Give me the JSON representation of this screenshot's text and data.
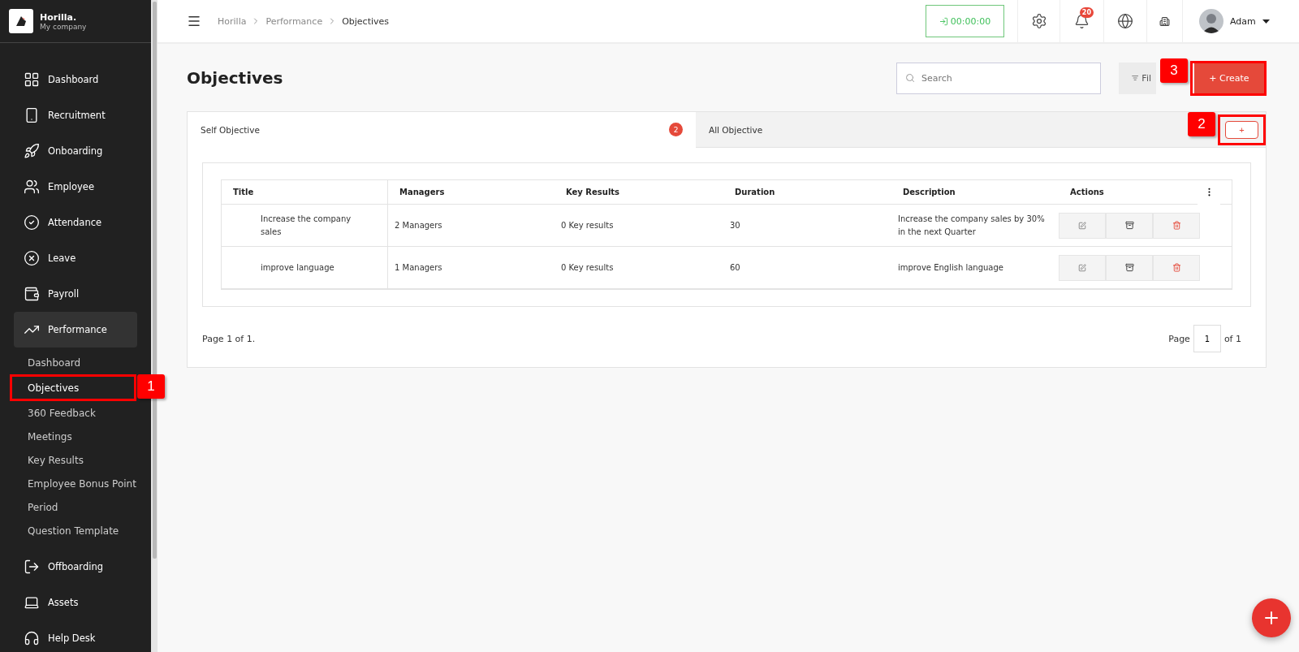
{
  "brand": {
    "name": "Horilla.",
    "company": "My company"
  },
  "nav": [
    {
      "label": "Dashboard",
      "selected": false
    },
    {
      "label": "Recruitment",
      "selected": false
    },
    {
      "label": "Onboarding",
      "selected": false
    },
    {
      "label": "Employee",
      "selected": false
    },
    {
      "label": "Attendance",
      "selected": false
    },
    {
      "label": "Leave",
      "selected": false
    },
    {
      "label": "Payroll",
      "selected": false
    },
    {
      "label": "Performance",
      "selected": true,
      "children": [
        {
          "label": "Dashboard",
          "selected": false
        },
        {
          "label": "Objectives",
          "selected": true,
          "callout": "1"
        },
        {
          "label": "360 Feedback",
          "selected": false
        },
        {
          "label": "Meetings",
          "selected": false
        },
        {
          "label": "Key Results",
          "selected": false
        },
        {
          "label": "Employee Bonus Point",
          "selected": false
        },
        {
          "label": "Period",
          "selected": false
        },
        {
          "label": "Question Template",
          "selected": false
        }
      ]
    },
    {
      "label": "Offboarding",
      "selected": false
    },
    {
      "label": "Assets",
      "selected": false
    },
    {
      "label": "Help Desk",
      "selected": false
    }
  ],
  "breadcrumb": [
    "Horilla",
    "Performance",
    "Objectives"
  ],
  "timer": "00:00:00",
  "notifications": "20",
  "user": "Adam",
  "page_title": "Objectives",
  "search": {
    "placeholder": "Search"
  },
  "filter_button": "Fil",
  "create_button": {
    "label": "+ Create",
    "callout": "3"
  },
  "tabs": [
    {
      "label": "Self Objective",
      "badge": "2",
      "selected": true
    },
    {
      "label": "All Objective",
      "selected": false
    }
  ],
  "add_tab_button": {
    "label": "+",
    "callout": "2"
  },
  "table": {
    "columns": [
      "Title",
      "Managers",
      "Key Results",
      "Duration",
      "Description",
      "Actions"
    ],
    "rows": [
      [
        "Increase the company sales",
        "2 Managers",
        "0 Key results",
        "30",
        "Increase the company sales by 30% in the next Quarter"
      ],
      [
        "improve language",
        "1 Managers",
        "0 Key results",
        "60",
        "improve English language"
      ]
    ]
  },
  "pagination": {
    "summary": "Page 1 of 1.",
    "label": "Page",
    "page": "1",
    "total": "of 1"
  }
}
